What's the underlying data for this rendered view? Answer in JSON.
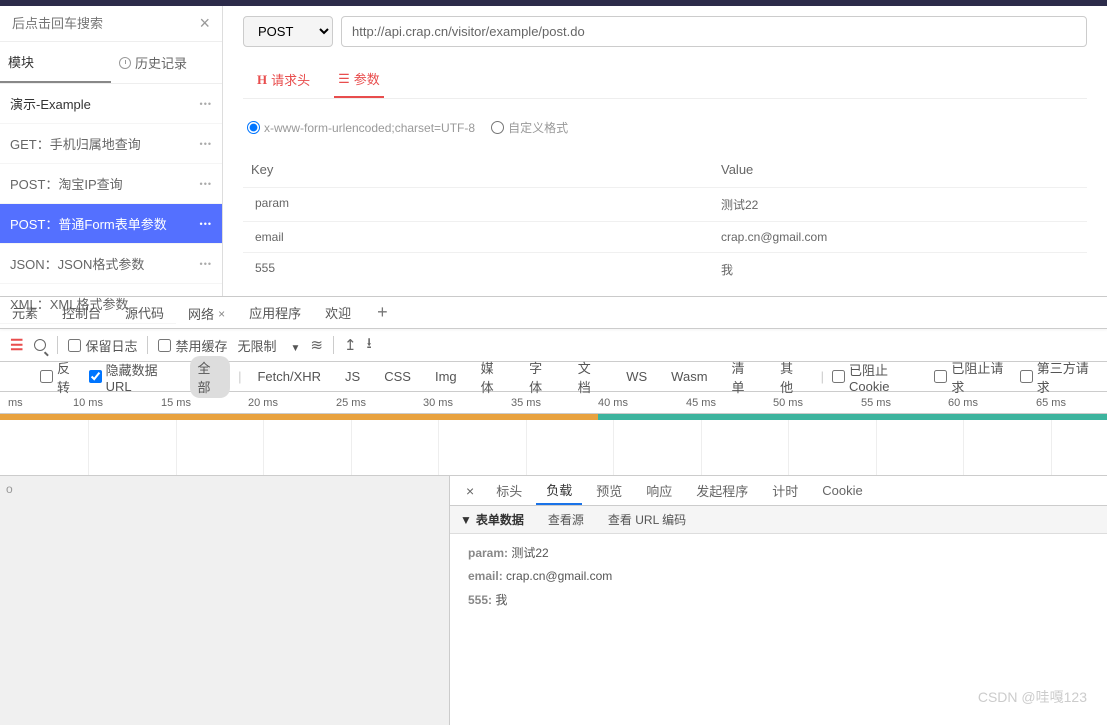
{
  "sidebar": {
    "search_placeholder": "后点击回车搜索",
    "tabs": {
      "module": "模块",
      "history": "历史记录"
    },
    "group": "演示-Example",
    "items": [
      {
        "label": "GET：手机归属地查询"
      },
      {
        "label": "POST：淘宝IP查询"
      },
      {
        "label": "POST：普通Form表单参数",
        "selected": true
      },
      {
        "label": "JSON：JSON格式参数"
      },
      {
        "label": "XML：XML格式参数"
      }
    ]
  },
  "request": {
    "method": "POST",
    "url": "http://api.crap.cn/visitor/example/post.do",
    "tabs": {
      "headers": "请求头",
      "params": "参数"
    },
    "content_type": {
      "form": "x-www-form-urlencoded;charset=UTF-8",
      "custom": "自定义格式"
    },
    "head": {
      "key": "Key",
      "value": "Value"
    },
    "rows": [
      {
        "key": "param",
        "value": "测试22"
      },
      {
        "key": "email",
        "value": "crap.cn@gmail.com"
      },
      {
        "key": "555",
        "value": "我"
      }
    ]
  },
  "devtools": {
    "tabs": {
      "elements": "元素",
      "console": "控制台",
      "sources": "源代码",
      "network": "网络",
      "application": "应用程序",
      "welcome": "欢迎"
    },
    "toolbar": {
      "preserve": "保留日志",
      "disable_cache": "禁用缓存",
      "throttle": "无限制"
    },
    "filters": {
      "invert": "反转",
      "hide_data": "隐藏数据 URL",
      "all": "全部",
      "types": [
        "Fetch/XHR",
        "JS",
        "CSS",
        "Img",
        "媒体",
        "字体",
        "文档",
        "WS",
        "Wasm",
        "清单",
        "其他"
      ],
      "blocked_cookie": "已阻止 Cookie",
      "blocked_req": "已阻止请求",
      "third_party": "第三方请求"
    },
    "timeline": [
      "ms",
      "10 ms",
      "15 ms",
      "20 ms",
      "25 ms",
      "30 ms",
      "35 ms",
      "40 ms",
      "45 ms",
      "50 ms",
      "55 ms",
      "60 ms",
      "65 ms"
    ]
  },
  "details": {
    "left_text": "o",
    "tabs": {
      "headers": "标头",
      "payload": "负载",
      "preview": "预览",
      "response": "响应",
      "initiator": "发起程序",
      "timing": "计时",
      "cookie": "Cookie"
    },
    "formdata": {
      "title": "表单数据",
      "view_source": "查看源",
      "view_url": "查看 URL 编码"
    },
    "items": [
      {
        "key": "param",
        "value": "测试22"
      },
      {
        "key": "email",
        "value": "crap.cn@gmail.com"
      },
      {
        "key": "555",
        "value": "我"
      }
    ]
  },
  "watermark": "CSDN @哇嘎123"
}
